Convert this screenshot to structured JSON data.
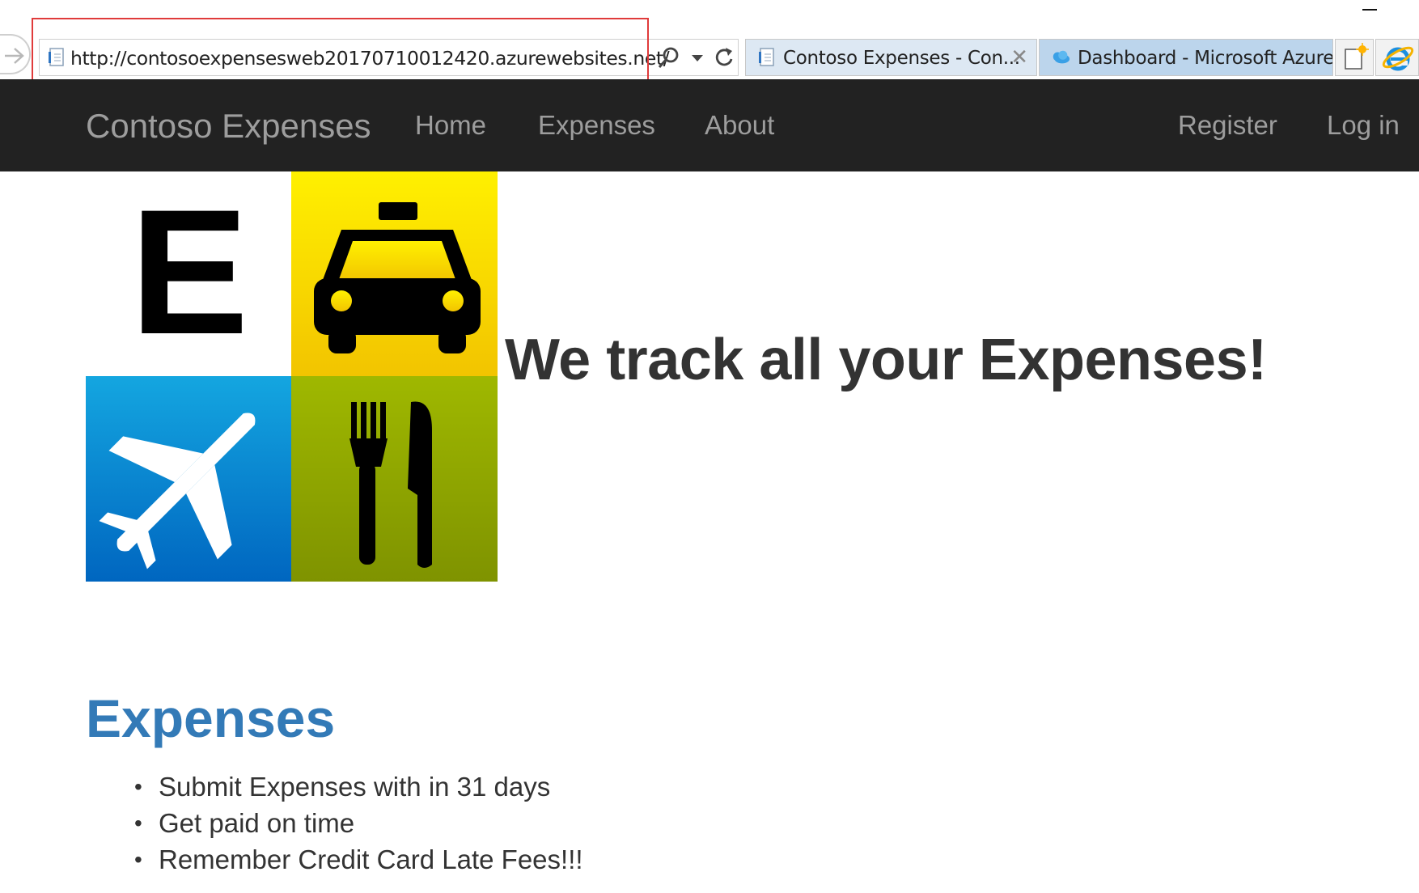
{
  "browser": {
    "address_bar": {
      "url": "http://contosoexpensesweb20170710012420.azurewebsites.net/"
    },
    "tabs": [
      {
        "title": "Contoso Expenses - Con...",
        "active": true,
        "close_glyph": "✕"
      },
      {
        "title": "Dashboard - Microsoft Azure",
        "active": false
      }
    ],
    "icons": [
      "back-arrow-icon",
      "page-icon",
      "search-icon",
      "dropdown-icon",
      "refresh-icon",
      "azure-cloud-icon",
      "new-tab-icon",
      "internet-explorer-icon",
      "minimize-icon"
    ],
    "highlight_color": "#e03b3b"
  },
  "navbar": {
    "brand": "Contoso Expenses",
    "links": [
      "Home",
      "Expenses",
      "About"
    ],
    "right_links": [
      "Register",
      "Log in"
    ],
    "background": "#222222",
    "link_color": "#9d9d9d"
  },
  "hero": {
    "headline": "We track all your Expenses!",
    "logo_tiles": [
      {
        "name": "letter-e",
        "letter": "E",
        "color": "#ffffff"
      },
      {
        "name": "taxi",
        "color": "#f7d800"
      },
      {
        "name": "airplane",
        "color": "#0a85cc"
      },
      {
        "name": "fork-and-knife",
        "color": "#8fa300"
      }
    ]
  },
  "expenses_section": {
    "title": "Expenses",
    "title_color": "#337ab7",
    "items": [
      "Submit Expenses with in 31 days",
      "Get paid on time",
      "Remember Credit Card Late Fees!!!"
    ]
  }
}
